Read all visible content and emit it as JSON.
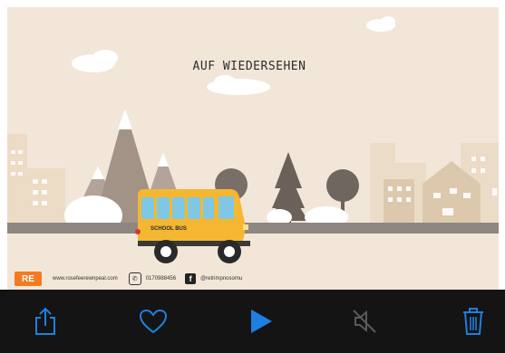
{
  "scene": {
    "title": "AUF WIEDERSEHEN",
    "bus_label": "SCHOOL BUS"
  },
  "footer": {
    "logo_text": "RE",
    "email": "www.rosefeerewnpeal.com",
    "phone": "0170988456",
    "social": "@retrimpnosomu"
  },
  "toolbar": {
    "buttons": [
      {
        "name": "share",
        "icon": "share-icon"
      },
      {
        "name": "favorite",
        "icon": "heart-icon"
      },
      {
        "name": "play",
        "icon": "play-icon"
      },
      {
        "name": "mute",
        "icon": "speaker-muted-icon"
      },
      {
        "name": "delete",
        "icon": "trash-icon"
      }
    ]
  },
  "colors": {
    "scene_bg": "#f2e6d8",
    "toolbar_bg": "#141414",
    "accent_blue": "#1f7fe0",
    "bus_yellow": "#f5b731",
    "logo_orange": "#f47a20"
  }
}
